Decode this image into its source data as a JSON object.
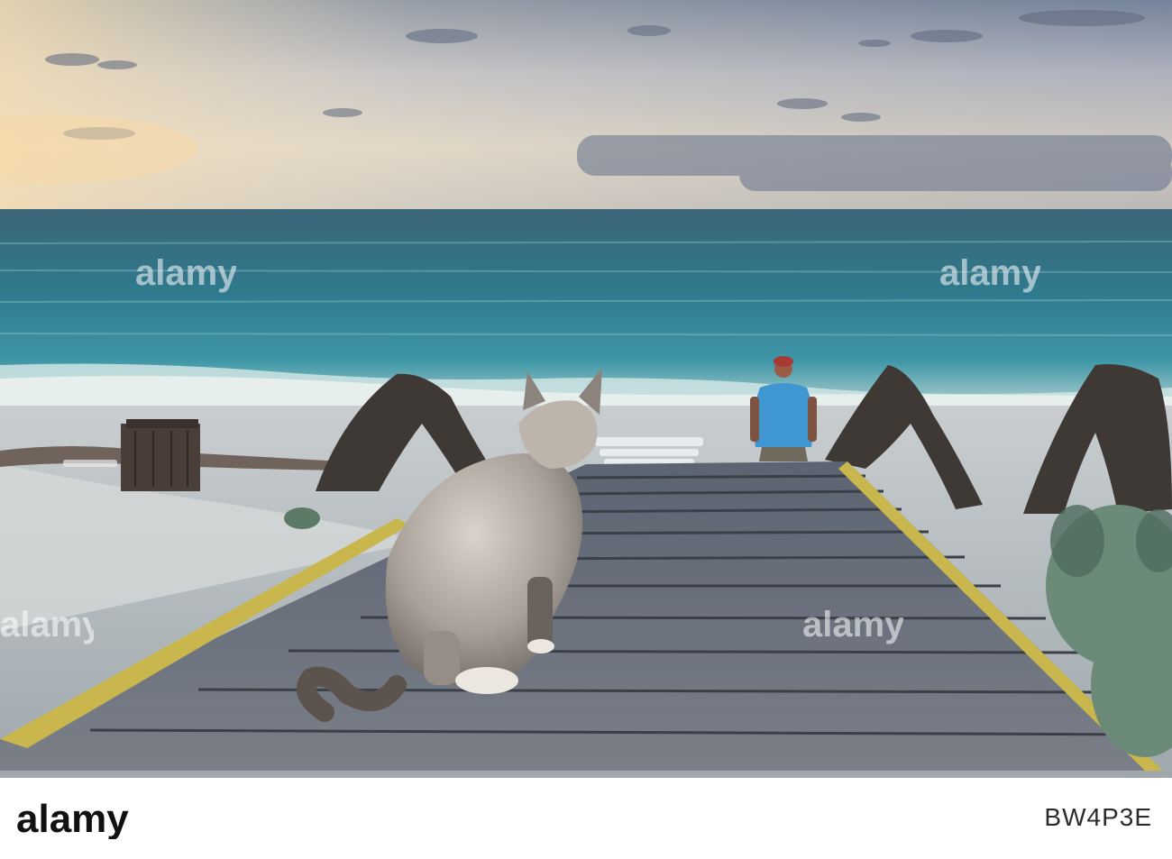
{
  "scene": {
    "description_tag": "beach-boardwalk-cat-sunset"
  },
  "watermark": {
    "text": "alamy"
  },
  "footer": {
    "logo_text": "alamy",
    "image_id": "BW4P3E"
  }
}
